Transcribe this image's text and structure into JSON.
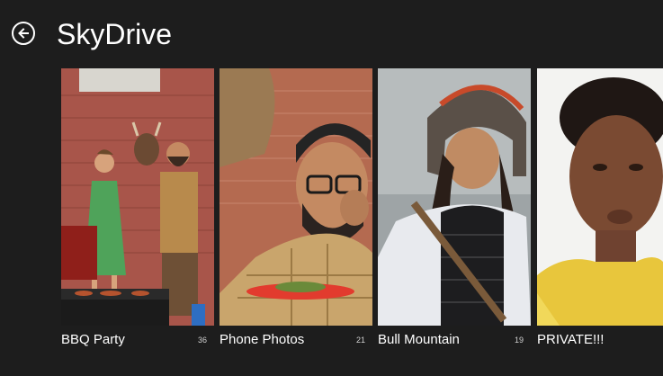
{
  "header": {
    "back_icon": "back-arrow-icon",
    "title": "SkyDrive"
  },
  "albums": [
    {
      "label": "BBQ Party",
      "count": "36"
    },
    {
      "label": "Phone Photos",
      "count": "21"
    },
    {
      "label": "Bull Mountain",
      "count": "19"
    },
    {
      "label": "PRIVATE!!!",
      "count": ""
    }
  ],
  "colors": {
    "background": "#1d1d1d",
    "text": "#ffffff"
  }
}
